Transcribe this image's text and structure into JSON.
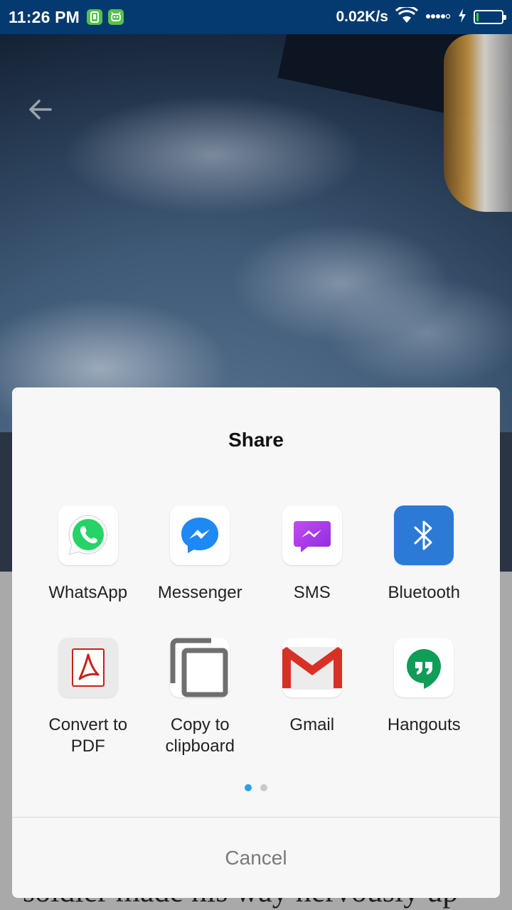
{
  "status_bar": {
    "time": "11:26 PM",
    "net_speed": "0.02K/s",
    "battery_level_percent": 10,
    "icons": [
      "app-notification-icon",
      "android-notification-icon",
      "wifi-icon",
      "signal-icon",
      "charging-icon",
      "battery-icon"
    ]
  },
  "background": {
    "article_snippet": "soldier made his way nervously up"
  },
  "share_dialog": {
    "title": "Share",
    "apps": [
      {
        "label": "WhatsApp",
        "icon": "whatsapp-icon",
        "color": "#25d366"
      },
      {
        "label": "Messenger",
        "icon": "messenger-icon",
        "color": "#1e88f5"
      },
      {
        "label": "SMS",
        "icon": "sms-icon",
        "color": "#a33be8"
      },
      {
        "label": "Bluetooth",
        "icon": "bluetooth-icon",
        "color": "#2b7ad6"
      },
      {
        "label": "Convert to\nPDF",
        "icon": "pdf-icon",
        "color": "#c8201b"
      },
      {
        "label": "Copy to\nclipboard",
        "icon": "clipboard-icon",
        "color": "#6f6f6f"
      },
      {
        "label": "Gmail",
        "icon": "gmail-icon",
        "color": "#d93025"
      },
      {
        "label": "Hangouts",
        "icon": "hangouts-icon",
        "color": "#0f9d58"
      }
    ],
    "pages": 2,
    "current_page": 1,
    "cancel_label": "Cancel"
  },
  "colors": {
    "status_bar": "#043a6f",
    "pager_active": "#2aa0e8"
  }
}
